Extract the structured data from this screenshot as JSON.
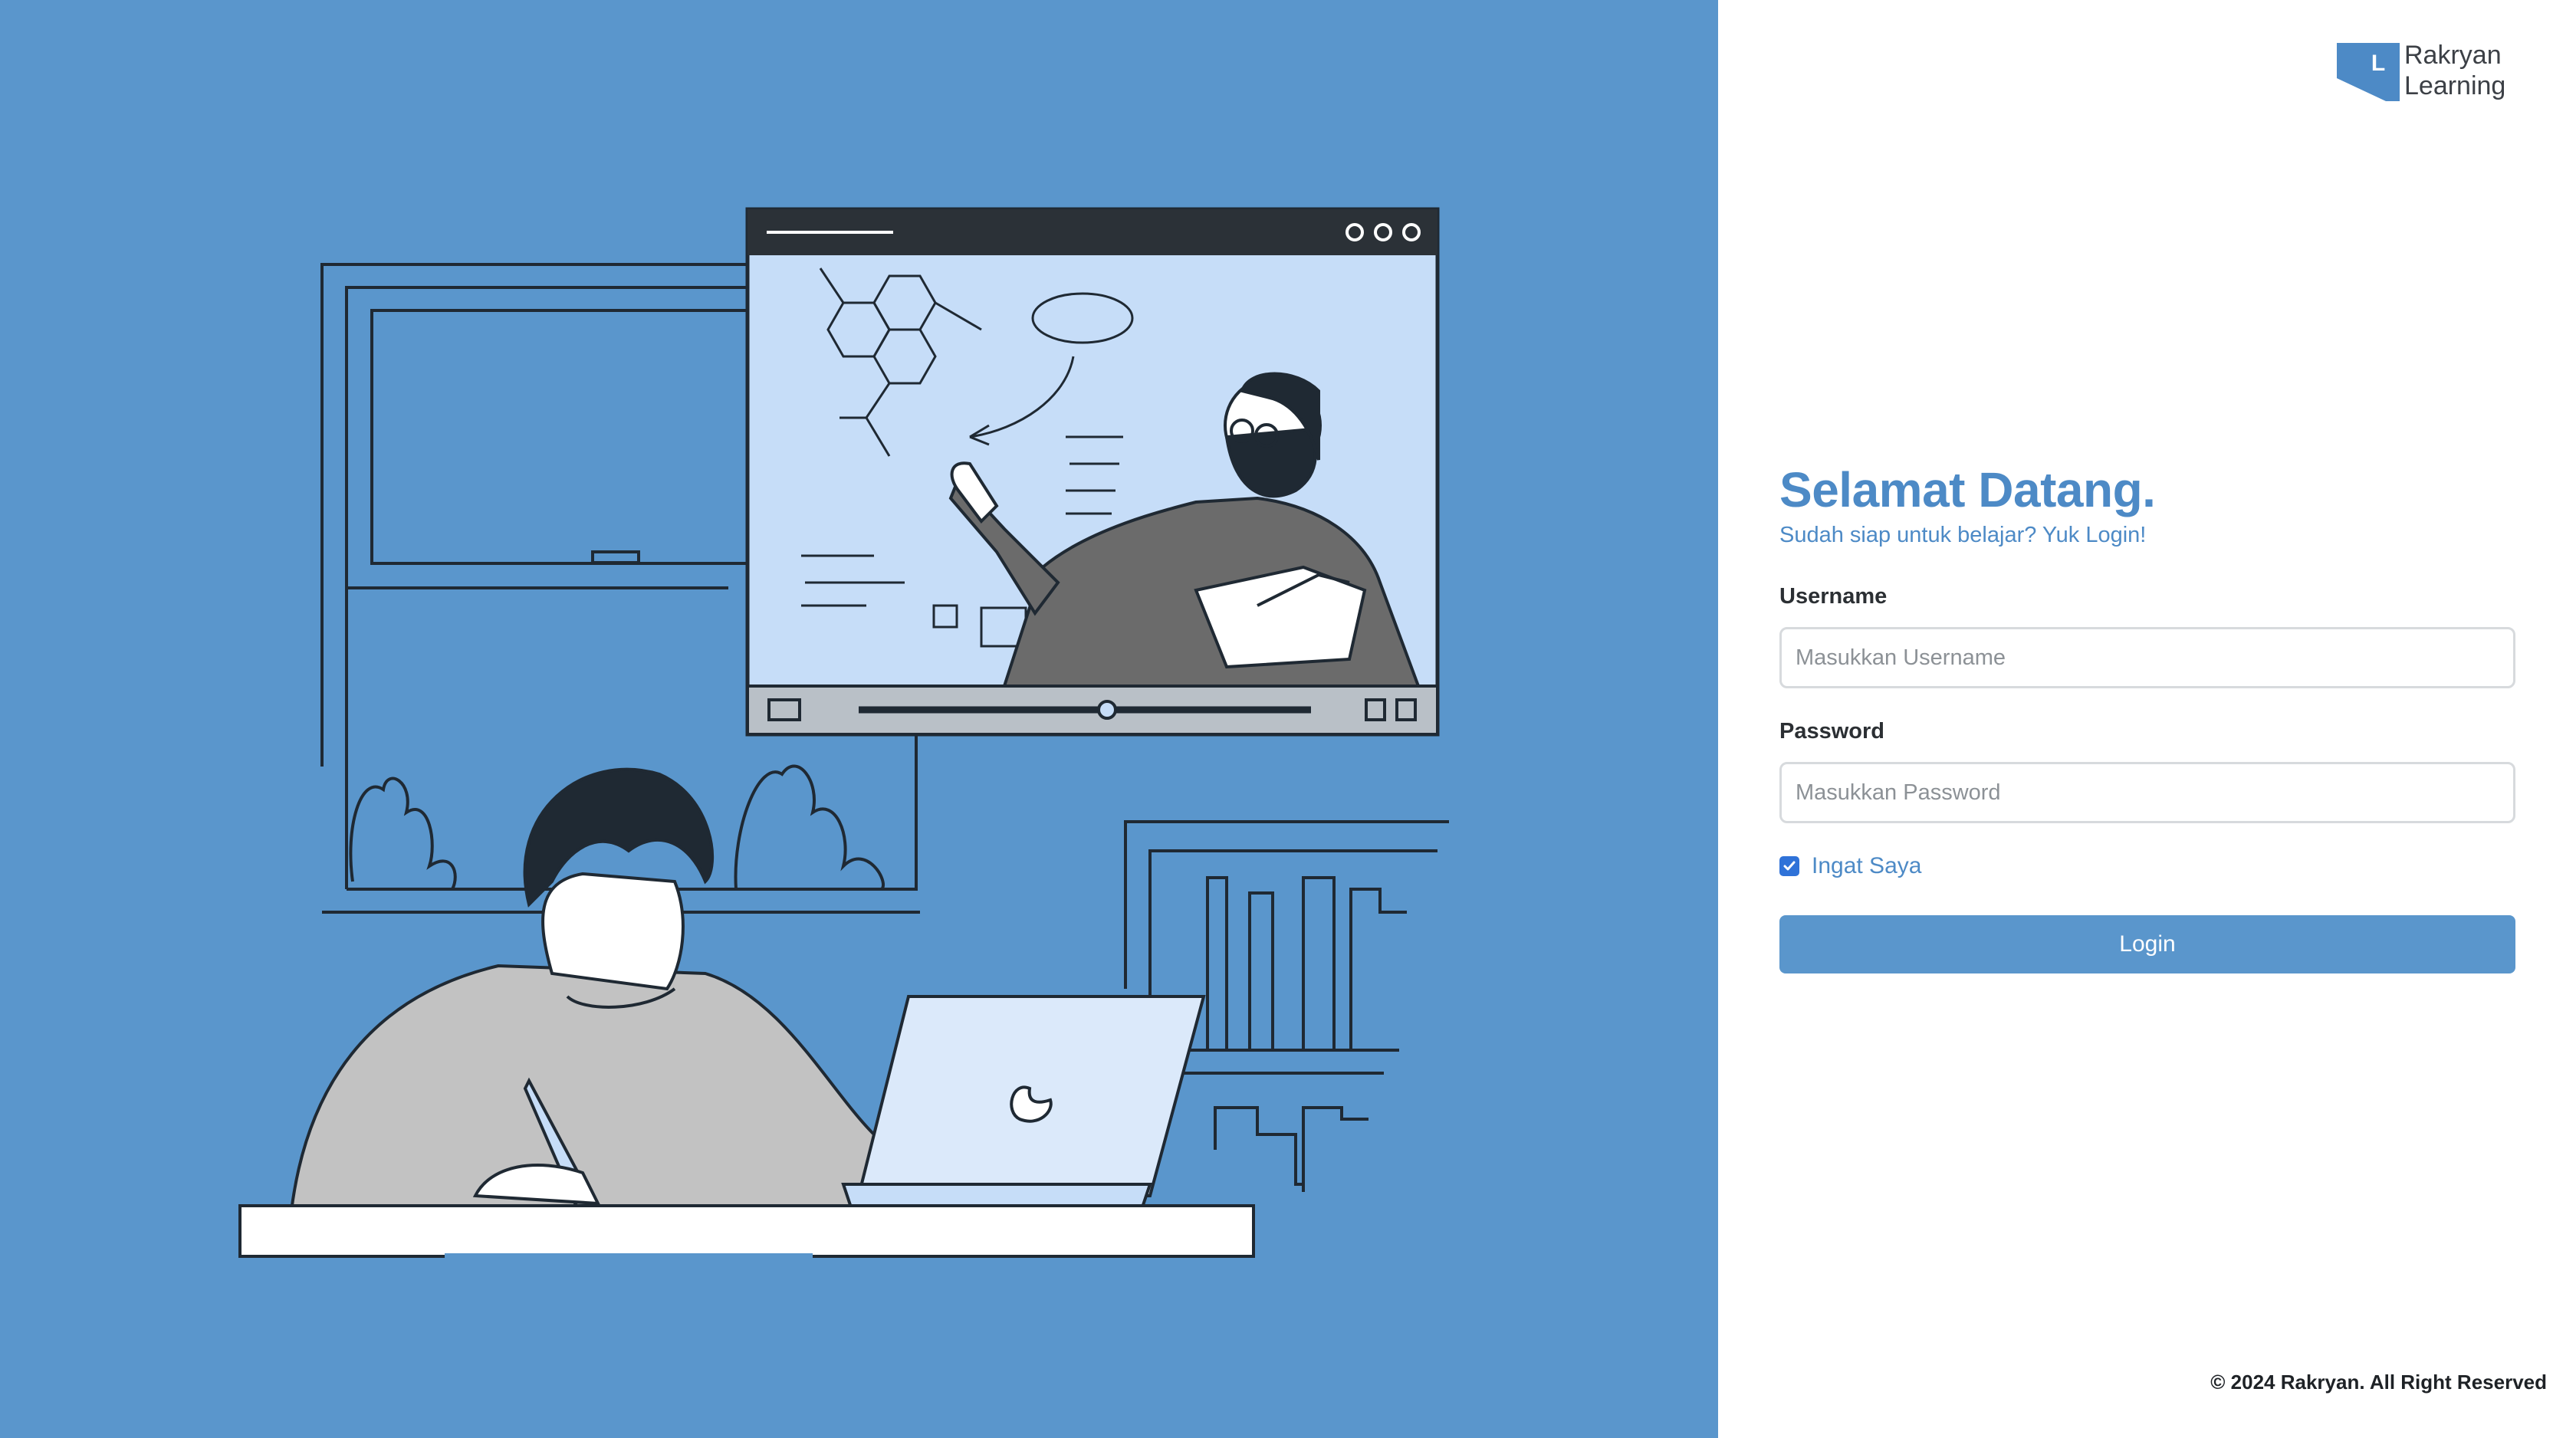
{
  "brand": {
    "logo_letter": "L",
    "name_line1": "Rakryan",
    "name_line2": "Learning",
    "logo_color": "#4d8ac6"
  },
  "illustration": {
    "background_color": "#5a96cc",
    "icon": "student-watching-online-class-illustration"
  },
  "login": {
    "title": "Selamat Datang.",
    "subtitle": "Sudah siap untuk belajar? Yuk Login!",
    "username_label": "Username",
    "username_placeholder": "Masukkan Username",
    "username_value": "",
    "password_label": "Password",
    "password_placeholder": "Masukkan Password",
    "password_value": "",
    "remember_label": "Ingat Saya",
    "remember_checked": true,
    "login_button": "Login",
    "accent_color": "#4d8ac6",
    "button_color": "#5a96cc"
  },
  "footer": {
    "copyright": "© 2024 Rakryan. All Right Reserved"
  }
}
